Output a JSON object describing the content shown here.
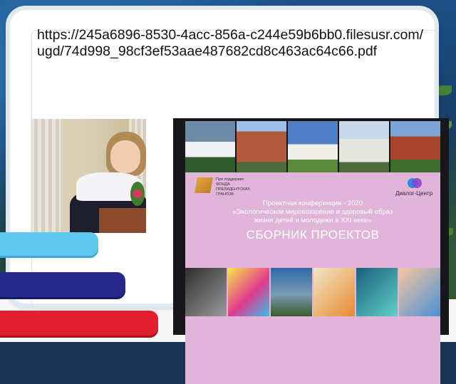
{
  "slide": {
    "link_text": "https://245a6896-8530-4acc-856a-c244e59b6bb0.filesusr.com/ugd/74d998_98cf3ef53aae487682cd8c463ac64c66.pdf"
  },
  "cover": {
    "fund_lines": [
      "При поддержке",
      "ФОНДА",
      "ПРЕЗИДЕНТСКИХ",
      "ГРАНТОВ"
    ],
    "partner": "Диалог-Центр",
    "conference_line1": "Проектная конференция - 2020",
    "conference_line2": "«Экологическое мировоззрение и здоровый образ",
    "conference_line3": "жизни детей и молодежи в XXI веке»",
    "heading": "СБОРНИК ПРОЕКТОВ"
  },
  "colors": {
    "bar_cyan": "#5fc8f0",
    "bar_navy": "#26288a",
    "bar_red": "#e02030",
    "cover_pink": "#e0b5d9"
  }
}
